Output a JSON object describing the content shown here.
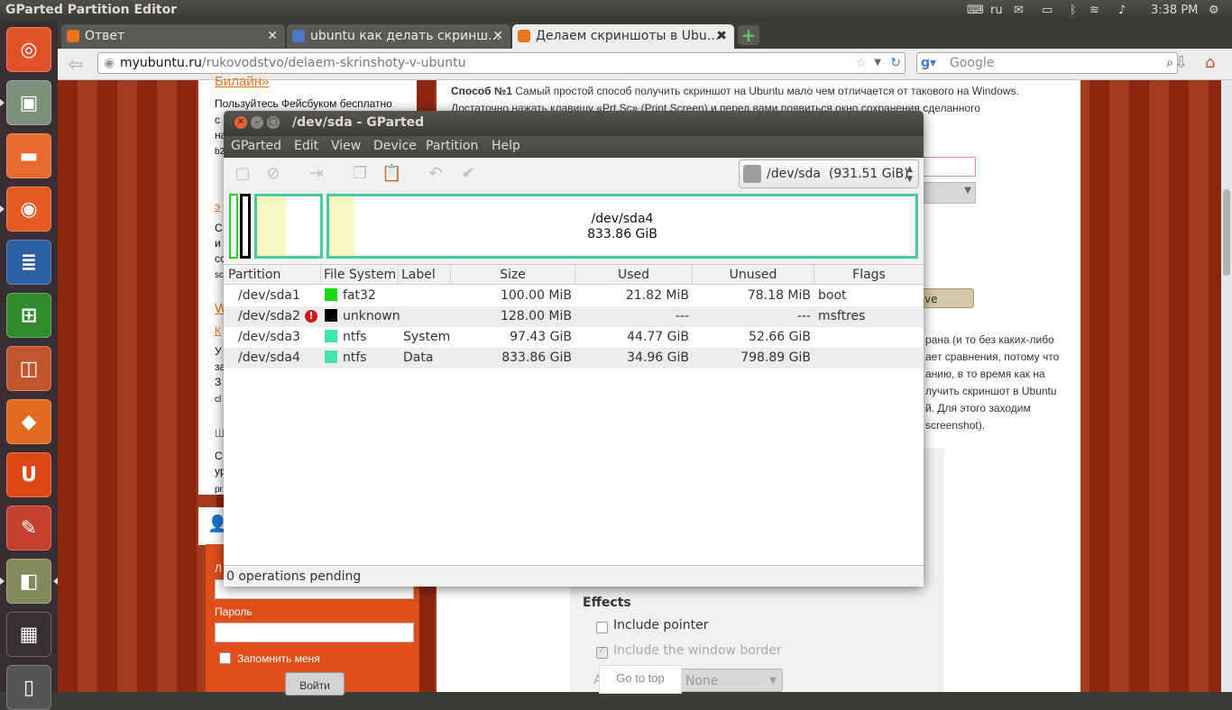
{
  "top_panel": {
    "title": "GParted Partition Editor",
    "keyboard_layout": "ru",
    "clock": "3:38 PM"
  },
  "launcher": {
    "items": [
      {
        "name": "dash-home",
        "color": "#e0532a"
      },
      {
        "name": "gparted",
        "color": "#7b8f7a"
      },
      {
        "name": "files",
        "color": "#e86b2e"
      },
      {
        "name": "firefox",
        "color": "#e45a1f"
      },
      {
        "name": "libreoffice-writer",
        "color": "#2b5fa2"
      },
      {
        "name": "libreoffice-calc",
        "color": "#2f8c2c"
      },
      {
        "name": "libreoffice-impress",
        "color": "#c2552b"
      },
      {
        "name": "software-center",
        "color": "#e06a1e"
      },
      {
        "name": "ubuntu-one",
        "color": "#dd4814"
      },
      {
        "name": "system-settings",
        "color": "#c4402c"
      },
      {
        "name": "disk-utility",
        "color": "#808a5d"
      },
      {
        "name": "workspace-switcher",
        "color": "#3a2f33"
      },
      {
        "name": "trash",
        "color": "#555"
      }
    ]
  },
  "browser": {
    "tabs": [
      {
        "label": "Ответ",
        "active": false
      },
      {
        "label": "ubuntu как делать скринш…",
        "active": false
      },
      {
        "label": "Делаем скриншоты в Ubu…",
        "active": true
      }
    ],
    "url_host": "myubuntu.ru",
    "url_path": "/rukovodstvo/delaem-skrinshoty-v-ubuntu",
    "search_placeholder": "Google"
  },
  "webpage": {
    "left": {
      "link1": "Билайн»",
      "text1": "Пользуйтесь Фейсбуком бесплатно",
      "line_c": "с",
      "line_na": "на",
      "line_b2": "b2",
      "line_e": "э",
      "line_s": "С",
      "line_i": "и",
      "line_co": "со",
      "line_sc": "sc",
      "link_w": "W",
      "link_k": "К",
      "line_u": "У",
      "line_za": "за",
      "line_3": "З",
      "line_cl": "cl",
      "line_sh": "Ш",
      "line_s2": "С",
      "line_ur": "ур",
      "line_pr": "pr"
    },
    "login": {
      "line_l": "Л",
      "password_label": "Пароль",
      "remember_label": "Запомнить меня",
      "submit": "Войти"
    },
    "main": {
      "heading": "Способ №1",
      "p1": "Самый простой способ получить скриншот на Ubuntu мало чем отличается от такового на Windows.",
      "p1b": "Достаточно нажать клавишу «Prt Sc» (Print Screen) и перед вами появиться окно сохранения сделанного",
      "save_btn_fragment": "ve",
      "right_lines": [
        "рана (и то без каких-либо",
        "ает сравнения, потому что",
        "анию, в то время как на",
        "лучить скриншот в Ubuntu",
        "й. Для этого заходим",
        "screenshot)."
      ]
    },
    "screenshot_panel": {
      "effects": "Effects",
      "include_pointer": "Include pointer",
      "include_border": "Include the window border",
      "effect_select": "None",
      "effect_label_fragment": "A"
    },
    "goto_top": "Go to top"
  },
  "gparted": {
    "title": "/dev/sda - GParted",
    "menu": [
      "GParted",
      "Edit",
      "View",
      "Device",
      "Partition",
      "Help"
    ],
    "device": "/dev/sda",
    "device_size": "(931.51 GiB)",
    "diskmap_label_name": "/dev/sda4",
    "diskmap_label_size": "833.86 GiB",
    "columns": [
      "Partition",
      "File System",
      "Label",
      "Size",
      "Used",
      "Unused",
      "Flags"
    ],
    "rows": [
      {
        "partition": "/dev/sda1",
        "fs": "fat32",
        "fs_color": "#18d918",
        "label": "",
        "size": "100.00 MiB",
        "used": "21.82 MiB",
        "unused": "78.18 MiB",
        "flags": "boot",
        "warn": false
      },
      {
        "partition": "/dev/sda2",
        "fs": "unknown",
        "fs_color": "#000000",
        "label": "",
        "size": "128.00 MiB",
        "used": "---",
        "unused": "---",
        "flags": "msftres",
        "warn": true
      },
      {
        "partition": "/dev/sda3",
        "fs": "ntfs",
        "fs_color": "#42e5ac",
        "label": "System",
        "size": "97.43 GiB",
        "used": "44.77 GiB",
        "unused": "52.66 GiB",
        "flags": "",
        "warn": false
      },
      {
        "partition": "/dev/sda4",
        "fs": "ntfs",
        "fs_color": "#42e5ac",
        "label": "Data",
        "size": "833.86 GiB",
        "used": "34.96 GiB",
        "unused": "798.89 GiB",
        "flags": "",
        "warn": false
      }
    ],
    "status": "0 operations pending",
    "warn_glyph": "!"
  }
}
